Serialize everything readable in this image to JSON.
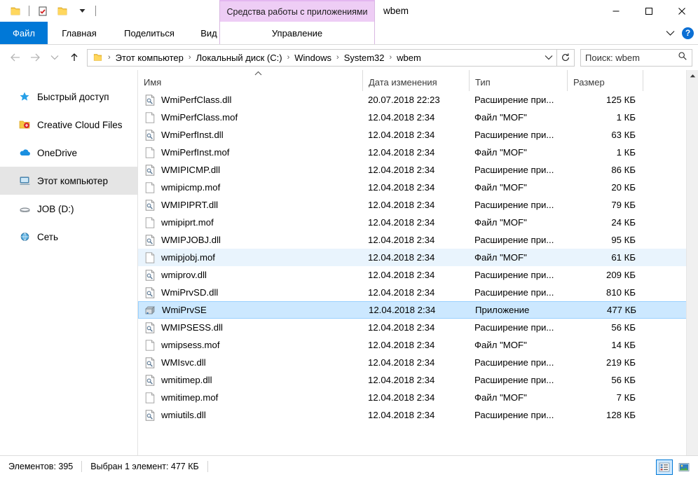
{
  "titlebar": {
    "quick_access": [
      {
        "name": "folder-icon",
        "label": "Проводник"
      },
      {
        "name": "properties-icon",
        "label": "Свойства"
      },
      {
        "name": "new-folder-icon",
        "label": "Создать папку"
      },
      {
        "name": "chevron-down-icon",
        "label": "Настроить панель быстрого доступа"
      }
    ],
    "contextual_group": "Средства работы с приложениями",
    "window_title": "wbem",
    "minimize": "—",
    "maximize": "□",
    "close": "✕"
  },
  "ribbon": {
    "tabs": [
      {
        "label": "Файл",
        "active": false,
        "style": "file"
      },
      {
        "label": "Главная",
        "active": false,
        "style": "home"
      },
      {
        "label": "Поделиться",
        "active": false,
        "style": "share"
      },
      {
        "label": "Вид",
        "active": false,
        "style": "view"
      }
    ],
    "contextual_tab": "Управление",
    "collapse_icon": "⌄",
    "help_label": "?"
  },
  "addressbar": {
    "back_icon": "←",
    "forward_icon": "→",
    "recent_icon": "⌄",
    "up_icon": "↑",
    "breadcrumbs": [
      "Этот компьютер",
      "Локальный диск (C:)",
      "Windows",
      "System32",
      "wbem"
    ],
    "breadcrumb_separator": "›",
    "dropdown_icon": "⌄",
    "refresh_icon": "↻",
    "search_value": "Поиск: wbem",
    "search_placeholder": "Поиск: wbem",
    "search_icon": "search-icon"
  },
  "sidebar": {
    "items": [
      {
        "label": "Быстрый доступ",
        "icon": "star-icon",
        "selected": false
      },
      {
        "label": "Creative Cloud Files",
        "icon": "creative-cloud-icon",
        "selected": false
      },
      {
        "label": "OneDrive",
        "icon": "cloud-icon",
        "selected": false
      },
      {
        "label": "Этот компьютер",
        "icon": "computer-icon",
        "selected": true
      },
      {
        "label": "JOB (D:)",
        "icon": "drive-icon",
        "selected": false
      },
      {
        "label": "Сеть",
        "icon": "network-icon",
        "selected": false
      }
    ]
  },
  "filelist": {
    "columns": [
      {
        "label": "Имя",
        "sorted": "asc",
        "sort_icon": "^"
      },
      {
        "label": "Дата изменения",
        "sorted": null
      },
      {
        "label": "Тип",
        "sorted": null
      },
      {
        "label": "Размер",
        "sorted": null
      }
    ],
    "rows": [
      {
        "name": "WmiPerfClass.dll",
        "date": "20.07.2018 22:23",
        "type": "Расширение при...",
        "size": "125 КБ",
        "icon": "dll-icon",
        "state": "normal"
      },
      {
        "name": "WmiPerfClass.mof",
        "date": "12.04.2018 2:34",
        "type": "Файл \"MOF\"",
        "size": "1 КБ",
        "icon": "mof-icon",
        "state": "normal"
      },
      {
        "name": "WmiPerfInst.dll",
        "date": "12.04.2018 2:34",
        "type": "Расширение при...",
        "size": "63 КБ",
        "icon": "dll-icon",
        "state": "normal"
      },
      {
        "name": "WmiPerfInst.mof",
        "date": "12.04.2018 2:34",
        "type": "Файл \"MOF\"",
        "size": "1 КБ",
        "icon": "mof-icon",
        "state": "normal"
      },
      {
        "name": "WMIPICMP.dll",
        "date": "12.04.2018 2:34",
        "type": "Расширение при...",
        "size": "86 КБ",
        "icon": "dll-icon",
        "state": "normal"
      },
      {
        "name": "wmipicmp.mof",
        "date": "12.04.2018 2:34",
        "type": "Файл \"MOF\"",
        "size": "20 КБ",
        "icon": "mof-icon",
        "state": "normal"
      },
      {
        "name": "WMIPIPRT.dll",
        "date": "12.04.2018 2:34",
        "type": "Расширение при...",
        "size": "79 КБ",
        "icon": "dll-icon",
        "state": "normal"
      },
      {
        "name": "wmipiprt.mof",
        "date": "12.04.2018 2:34",
        "type": "Файл \"MOF\"",
        "size": "24 КБ",
        "icon": "mof-icon",
        "state": "normal"
      },
      {
        "name": "WMIPJOBJ.dll",
        "date": "12.04.2018 2:34",
        "type": "Расширение при...",
        "size": "95 КБ",
        "icon": "dll-icon",
        "state": "normal"
      },
      {
        "name": "wmipjobj.mof",
        "date": "12.04.2018 2:34",
        "type": "Файл \"MOF\"",
        "size": "61 КБ",
        "icon": "mof-icon",
        "state": "hover"
      },
      {
        "name": "wmiprov.dll",
        "date": "12.04.2018 2:34",
        "type": "Расширение при...",
        "size": "209 КБ",
        "icon": "dll-icon",
        "state": "normal"
      },
      {
        "name": "WmiPrvSD.dll",
        "date": "12.04.2018 2:34",
        "type": "Расширение при...",
        "size": "810 КБ",
        "icon": "dll-icon",
        "state": "normal"
      },
      {
        "name": "WmiPrvSE",
        "date": "12.04.2018 2:34",
        "type": "Приложение",
        "size": "477 КБ",
        "icon": "exe-icon",
        "state": "selected"
      },
      {
        "name": "WMIPSESS.dll",
        "date": "12.04.2018 2:34",
        "type": "Расширение при...",
        "size": "56 КБ",
        "icon": "dll-icon",
        "state": "normal"
      },
      {
        "name": "wmipsess.mof",
        "date": "12.04.2018 2:34",
        "type": "Файл \"MOF\"",
        "size": "14 КБ",
        "icon": "mof-icon",
        "state": "normal"
      },
      {
        "name": "WMIsvc.dll",
        "date": "12.04.2018 2:34",
        "type": "Расширение при...",
        "size": "219 КБ",
        "icon": "dll-icon",
        "state": "normal"
      },
      {
        "name": "wmitimep.dll",
        "date": "12.04.2018 2:34",
        "type": "Расширение при...",
        "size": "56 КБ",
        "icon": "dll-icon",
        "state": "normal"
      },
      {
        "name": "wmitimep.mof",
        "date": "12.04.2018 2:34",
        "type": "Файл \"MOF\"",
        "size": "7 КБ",
        "icon": "mof-icon",
        "state": "normal"
      },
      {
        "name": "wmiutils.dll",
        "date": "12.04.2018 2:34",
        "type": "Расширение при...",
        "size": "128 КБ",
        "icon": "dll-icon",
        "state": "normal"
      }
    ]
  },
  "statusbar": {
    "item_count": "Элементов: 395",
    "selection": "Выбран 1 элемент: 477 КБ",
    "view_details_icon": "details-view-icon",
    "view_tiles_icon": "large-icons-view-icon"
  },
  "colors": {
    "accent": "#0078d7",
    "selection": "#cce8ff",
    "hover": "#e9f4fd",
    "contextual_tab": "#eecdf5",
    "folder_yellow": "#f8c83c"
  }
}
